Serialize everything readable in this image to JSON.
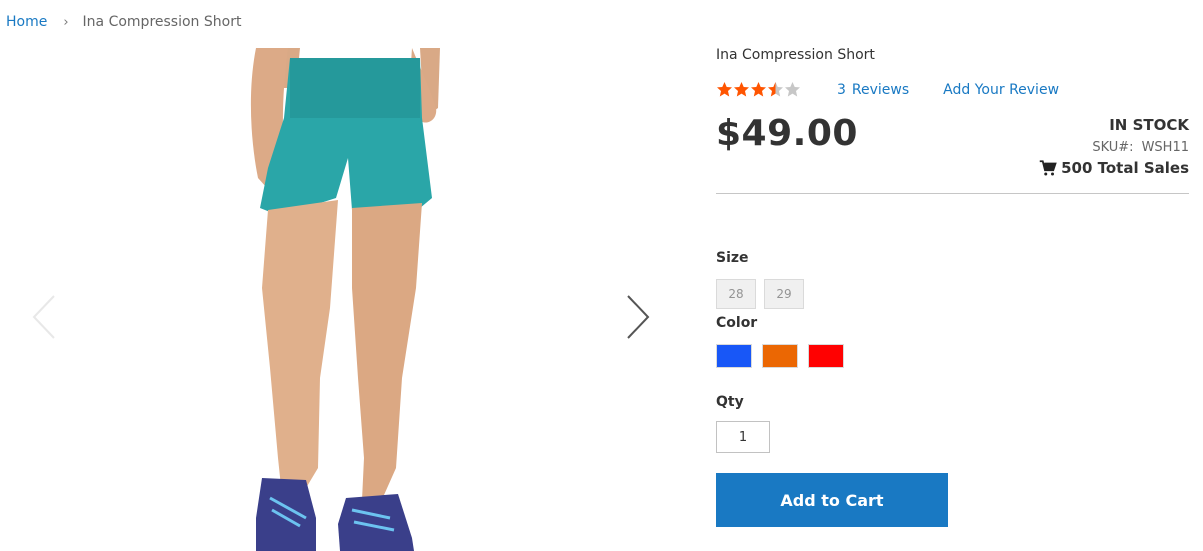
{
  "breadcrumb": {
    "home": "Home",
    "separator": "›",
    "current": "Ina Compression Short"
  },
  "product": {
    "title": "Ina Compression Short",
    "rating_fraction": 0.7,
    "stars_total": 5,
    "reviews_count": "3",
    "reviews_label": "Reviews",
    "add_review_label": "Add Your Review",
    "price": "$49.00",
    "stock": "IN STOCK",
    "sku_label": "SKU#:",
    "sku": "WSH11",
    "total_sales": "500 Total Sales"
  },
  "options": {
    "size_label": "Size",
    "sizes": [
      "28",
      "29"
    ],
    "color_label": "Color",
    "colors": [
      "#1857f7",
      "#eb6703",
      "#ff0101"
    ]
  },
  "qty": {
    "label": "Qty",
    "value": "1"
  },
  "cart": {
    "button_label": "Add to Cart"
  },
  "colors": {
    "accent": "#1979c3",
    "star": "#ff5501",
    "star_empty": "#c7c7c7",
    "shorts": "#2aa6a8",
    "shoes": "#3a3f8a",
    "skin": "#e0b08c"
  },
  "icons": {
    "prev": "chevron-left-icon",
    "next": "chevron-right-icon",
    "cart": "shopping-cart-icon"
  }
}
